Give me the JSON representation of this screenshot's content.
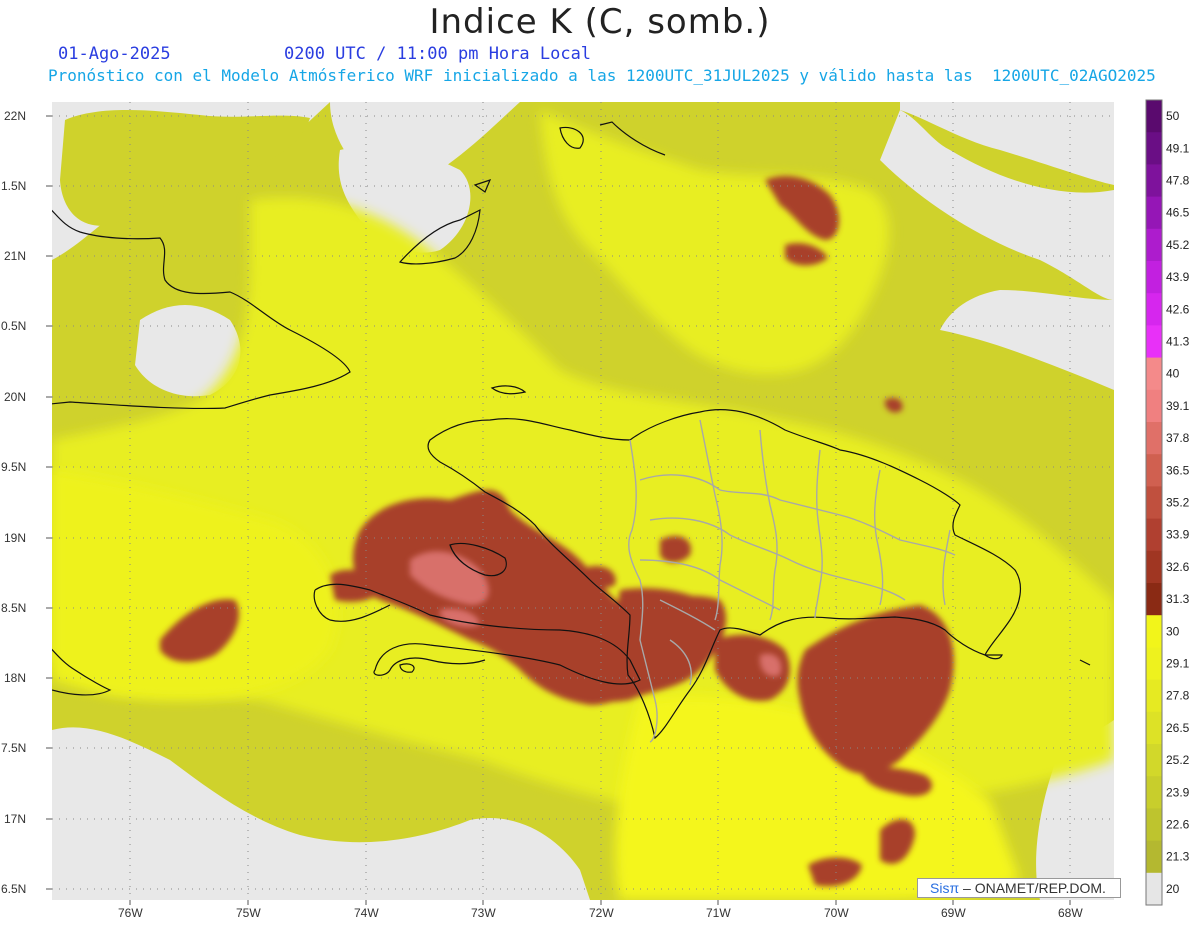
{
  "title": "Indice K (C, somb.)",
  "date_label": "01-Ago-2025",
  "time_label": "0200 UTC / 11:00 pm Hora Local",
  "forecast_label": "Pronóstico con el Modelo Atmósferico WRF inicializado a las 1200UTC_31JUL2025 y válido hasta las  1200UTC_02AGO2025",
  "credit": {
    "prefix": "Sis",
    "pi": "π",
    "suffix": "– ONAMET/REP.DOM."
  },
  "lat_labels": [
    "22N",
    "1.5N",
    "21N",
    "0.5N",
    "20N",
    "9.5N",
    "19N",
    "8.5N",
    "18N",
    "7.5N",
    "17N",
    "6.5N"
  ],
  "lon_labels": [
    "76W",
    "75W",
    "74W",
    "73W",
    "72W",
    "71W",
    "70W",
    "69W",
    "68W"
  ],
  "colorbar": {
    "levels": [
      "50",
      "49.1",
      "47.8",
      "46.5",
      "45.2",
      "43.9",
      "42.6",
      "41.3",
      "40",
      "39.1",
      "37.8",
      "36.5",
      "35.2",
      "33.9",
      "32.6",
      "31.3",
      "30",
      "29.1",
      "27.8",
      "26.5",
      "25.2",
      "23.9",
      "22.6",
      "21.3",
      "20"
    ],
    "colors": [
      "#5a0a6e",
      "#6a0e85",
      "#7e129c",
      "#9516b6",
      "#ad1ccd",
      "#c220e0",
      "#d626ee",
      "#e830f8",
      "#f48a8a",
      "#f08080",
      "#e07068",
      "#d06050",
      "#c0503e",
      "#b04030",
      "#a03622",
      "#8a2a14",
      "#f2f51a",
      "#eef21e",
      "#e6ea22",
      "#dde226",
      "#d2d82a",
      "#c8ce2c",
      "#bec42e",
      "#b4b830",
      "#e6e6e6"
    ]
  },
  "colors": {
    "land_bg": "#e8e8e8",
    "k_low": "#cfd22c",
    "k_mid": "#e8ee22",
    "k_high": "#f4f61a",
    "k_severe": "#a8402c",
    "k_extreme": "#d8706a"
  }
}
